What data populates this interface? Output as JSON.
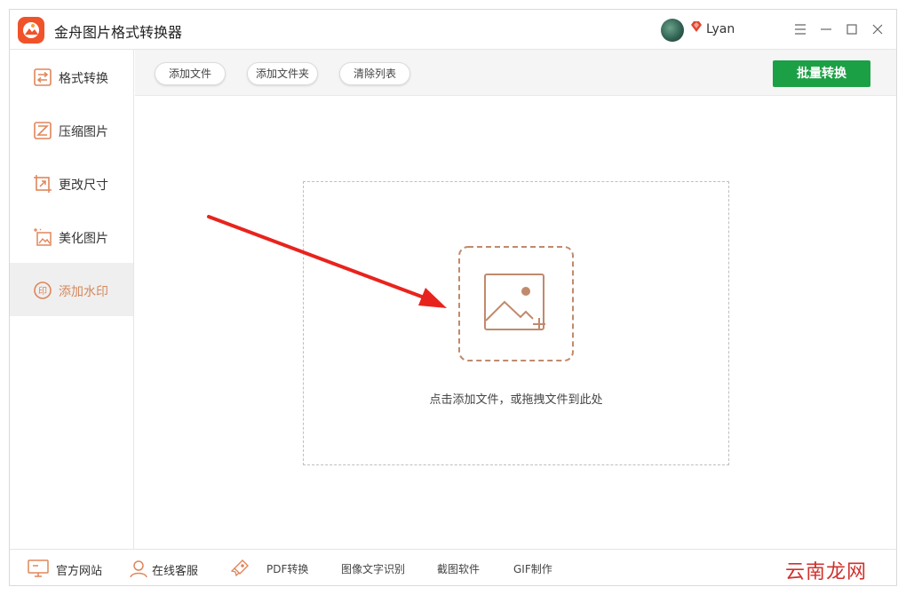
{
  "app": {
    "title": "金舟图片格式转换器",
    "logo_icon": "mountain-sun-logo-icon",
    "brand_color": "#f0522a"
  },
  "user": {
    "name": "Lyan",
    "vip_icon": "diamond-icon"
  },
  "window_controls": {
    "menu": "menu-icon",
    "minimize": "minimize-icon",
    "maximize": "maximize-icon",
    "close": "close-icon"
  },
  "sidebar": {
    "items": [
      {
        "label": "格式转换",
        "icon": "swap-arrows-icon"
      },
      {
        "label": "压缩图片",
        "icon": "compress-icon"
      },
      {
        "label": "更改尺寸",
        "icon": "resize-icon"
      },
      {
        "label": "美化图片",
        "icon": "beautify-image-icon"
      },
      {
        "label": "添加水印",
        "icon": "stamp-yin-icon"
      }
    ],
    "active_index": 4,
    "active_color": "#d4885c"
  },
  "toolbar": {
    "add_file": "添加文件",
    "add_folder": "添加文件夹",
    "clear_list": "清除列表",
    "batch_convert": "批量转换",
    "batch_color": "#1ca045"
  },
  "main": {
    "dropzone_hint": "点击添加文件，或拖拽文件到此处",
    "upload_icon": "add-image-icon"
  },
  "footer": {
    "items": [
      {
        "label": "官方网站",
        "icon": "monitor-icon"
      },
      {
        "label": "在线客服",
        "icon": "user-support-icon"
      },
      {
        "label": "PDF转换",
        "icon": "rocket-icon"
      },
      {
        "label": "图像文字识别"
      },
      {
        "label": "截图软件"
      },
      {
        "label": "GIF制作"
      }
    ]
  },
  "watermark": {
    "text": "云南龙网"
  }
}
